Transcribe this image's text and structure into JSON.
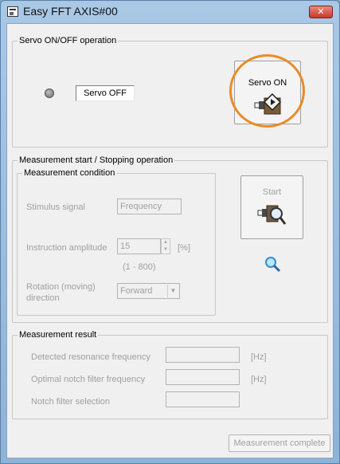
{
  "window": {
    "title": "Easy FFT AXIS#00",
    "close_label": "✕"
  },
  "servo": {
    "group_label": "Servo ON/OFF operation",
    "status_text": "Servo OFF",
    "button_label": "Servo ON"
  },
  "measurement": {
    "group_label": "Measurement start / Stopping operation",
    "condition_label": "Measurement condition",
    "stimulus_label": "Stimulus signal",
    "stimulus_value": "Frequency",
    "amplitude_label": "Instruction amplitude",
    "amplitude_value": "15",
    "amplitude_unit": "[%]",
    "amplitude_range": "(1 - 800)",
    "rotation_label_1": "Rotation (moving)",
    "rotation_label_2": "direction",
    "rotation_value": "Forward",
    "start_label": "Start"
  },
  "result": {
    "group_label": "Measurement result",
    "resonance_label": "Detected resonance frequency",
    "resonance_unit": "[Hz]",
    "notch_label": "Optimal notch filter frequency",
    "notch_unit": "[Hz]",
    "selection_label": "Notch filter selection"
  },
  "footer": {
    "complete_label": "Measurement complete"
  },
  "colors": {
    "highlight": "#e98b2a",
    "disabled_text": "#a0a0a0"
  }
}
